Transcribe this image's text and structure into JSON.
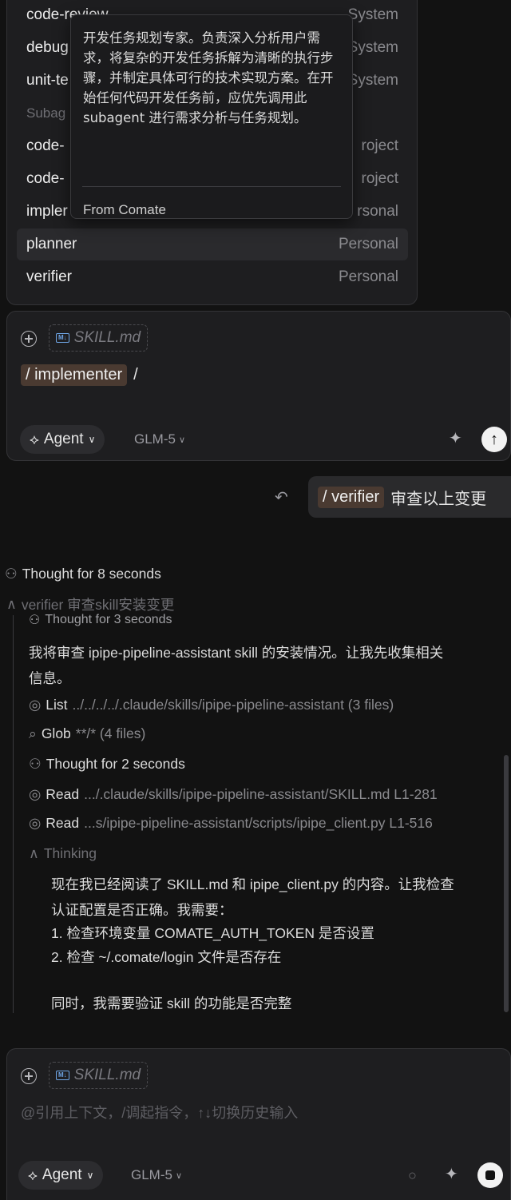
{
  "dropdown": {
    "items": [
      {
        "name": "code-review",
        "source": "System"
      },
      {
        "name": "debug",
        "source": "System"
      },
      {
        "name": "unit-te",
        "source": "System"
      },
      {
        "section": "Subag"
      },
      {
        "name": "code-",
        "source": "roject"
      },
      {
        "name": "code-",
        "source": "roject"
      },
      {
        "name": "impler",
        "source": "rsonal"
      },
      {
        "name": "planner",
        "source": "Personal"
      },
      {
        "name": "verifier",
        "source": "Personal"
      }
    ],
    "selected_index": 7
  },
  "tooltip": {
    "description": "开发任务规划专家。负责深入分析用户需求，将复杂的开发任务拆解为清晰的执行步骤，并制定具体可行的技术实现方案。在开始任何代码开发任务前，应优先调用此 subagent 进行需求分析与任务规划。",
    "source": "From Comate"
  },
  "composer_top": {
    "file_chip": "SKILL.md",
    "command": "/ implementer",
    "trailing": "/",
    "mode": "Agent",
    "model": "GLM-5"
  },
  "user_message": {
    "command": "/ verifier",
    "text": "审查以上变更"
  },
  "log": {
    "thought_main": "Thought for 8 seconds",
    "subagent_header": "verifier 审查skill安装变更",
    "thought_sub": "Thought for 3 seconds",
    "intro_line1": "我将审查 ipipe-pipeline-assistant skill 的安装情况。让我先收集相关",
    "intro_line2": "信息。",
    "list_label": "List",
    "list_path": "../../../../.claude/skills/ipipe-pipeline-assistant (3 files)",
    "glob_label": "Glob",
    "glob_path": "**/* (4 files)",
    "thought_2s": "Thought for 2 seconds",
    "read1_label": "Read",
    "read1_path": ".../.claude/skills/ipipe-pipeline-assistant/SKILL.md L1-281",
    "read2_label": "Read",
    "read2_path": "...s/ipipe-pipeline-assistant/scripts/ipipe_client.py L1-516",
    "thinking_label": "Thinking",
    "thinking_lines": [
      "现在我已经阅读了 SKILL.md 和 ipipe_client.py 的内容。让我检查",
      "认证配置是否正确。我需要：",
      "1. 检查环境变量 COMATE_AUTH_TOKEN 是否设置",
      "2. 检查 ~/.comate/login 文件是否存在",
      "",
      "同时，我需要验证 skill 的功能是否完整"
    ]
  },
  "composer_bottom": {
    "file_chip": "SKILL.md",
    "placeholder": "@引用上下文，/调起指令，↑↓切换历史输入",
    "mode": "Agent",
    "model": "GLM-5"
  }
}
